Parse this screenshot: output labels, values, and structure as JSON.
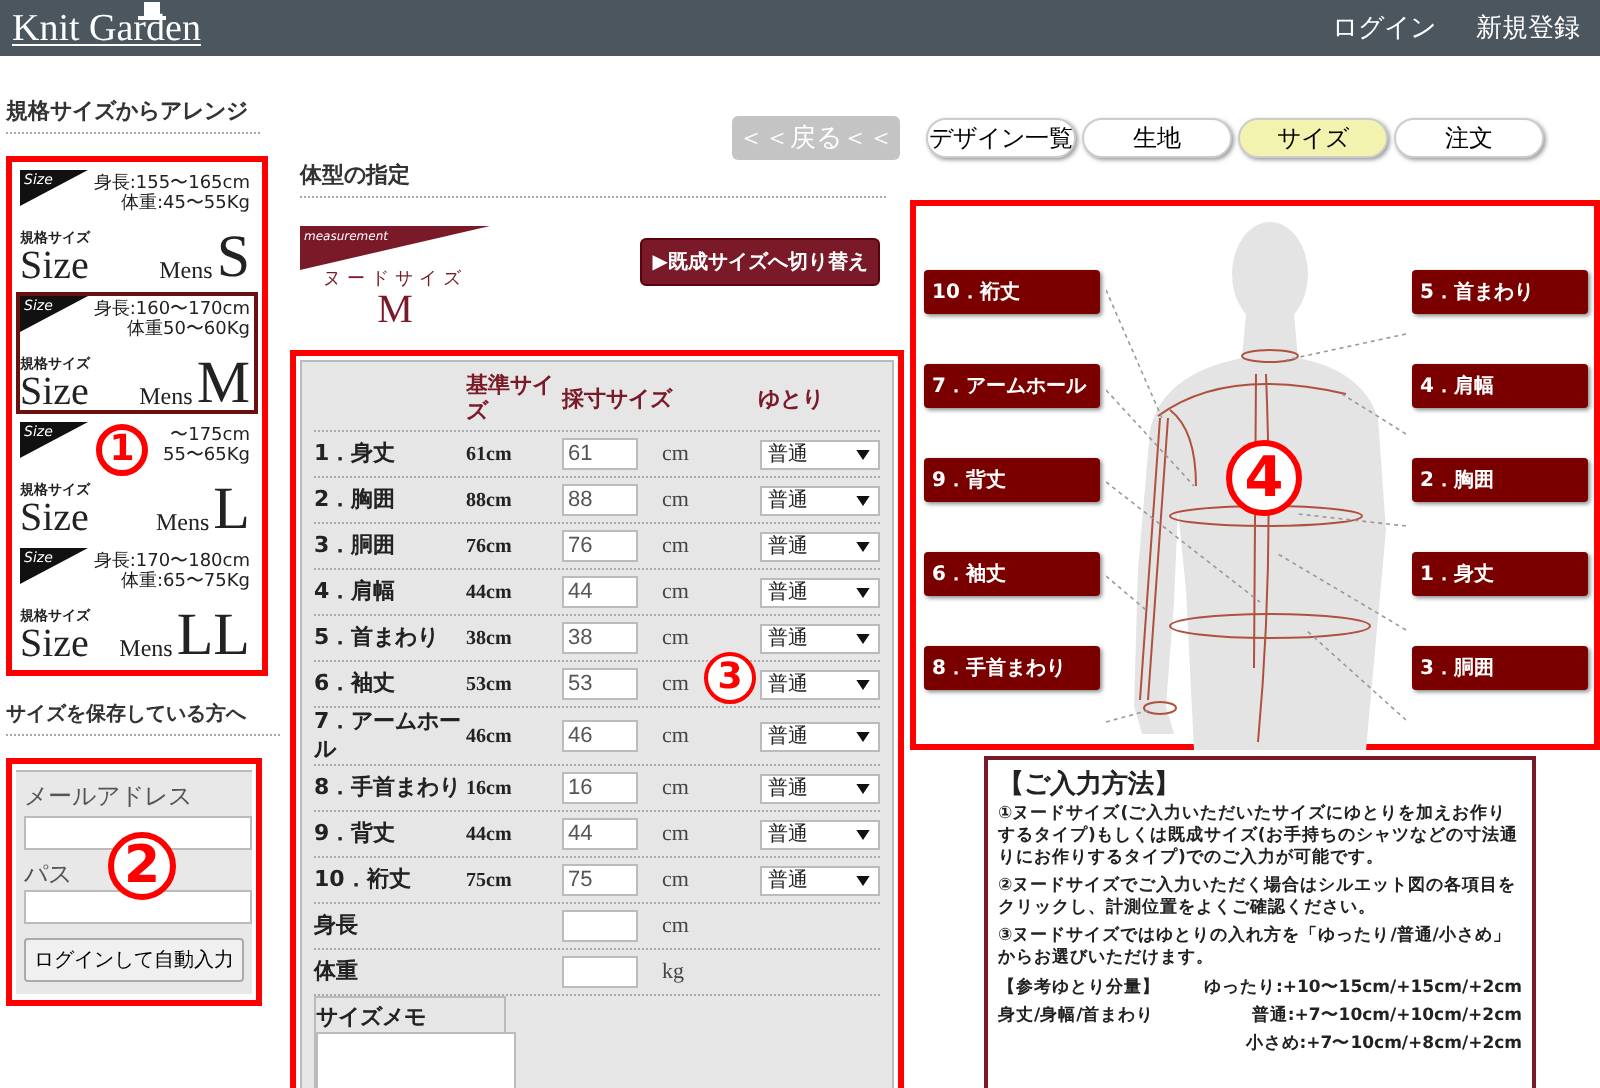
{
  "header": {
    "logo": "Knit Garden",
    "links": [
      "ログイン",
      "新規登録"
    ]
  },
  "size_preset": {
    "heading": "規格サイズからアレンジ",
    "annotation": "1",
    "cards": [
      {
        "tag": "Size",
        "height": "身長:155〜165cm",
        "weight": "体重:45〜55Kg",
        "caption": "規格サイズ",
        "size_word": "Size",
        "gender": "Mens",
        "size": "S",
        "selected": false
      },
      {
        "tag": "Size",
        "height": "身長:160〜170cm",
        "weight": "体重50〜60Kg",
        "caption": "規格サイズ",
        "size_word": "Size",
        "gender": "Mens",
        "size": "M",
        "selected": true
      },
      {
        "tag": "Size",
        "height": "〜175cm",
        "weight": "55〜65Kg",
        "caption": "規格サイズ",
        "size_word": "Size",
        "gender": "Mens",
        "size": "L",
        "selected": false
      },
      {
        "tag": "Size",
        "height": "身長:170〜180cm",
        "weight": "体重:65〜75Kg",
        "caption": "規格サイズ",
        "size_word": "Size",
        "gender": "Mens",
        "size": "LL",
        "selected": false
      }
    ]
  },
  "saved_login": {
    "heading": "サイズを保存している方へ",
    "annotation": "2",
    "email_label": "メールアドレス",
    "password_label": "パス",
    "button": "ログインして自動入力"
  },
  "back_button": "＜＜戻る＜＜",
  "body_spec": {
    "heading": "体型の指定",
    "banner": "measurement",
    "mode": "ヌードサイズ",
    "size": "M",
    "switch_button": "▶既成サイズへ切り替え",
    "annotation": "3",
    "columns": [
      "基準サイズ",
      "採寸サイズ",
      "ゆとり"
    ],
    "rows": [
      {
        "kind": "measure",
        "label": "1．身丈",
        "base": "61cm",
        "value": "61",
        "unit": "cm",
        "allowance": "普通"
      },
      {
        "kind": "measure",
        "label": "2．胸囲",
        "base": "88cm",
        "value": "88",
        "unit": "cm",
        "allowance": "普通"
      },
      {
        "kind": "measure",
        "label": "3．胴囲",
        "base": "76cm",
        "value": "76",
        "unit": "cm",
        "allowance": "普通"
      },
      {
        "kind": "measure",
        "label": "4．肩幅",
        "base": "44cm",
        "value": "44",
        "unit": "cm",
        "allowance": "普通"
      },
      {
        "kind": "measure",
        "label": "5．首まわり",
        "base": "38cm",
        "value": "38",
        "unit": "cm",
        "allowance": "普通"
      },
      {
        "kind": "measure",
        "label": "6．袖丈",
        "base": "53cm",
        "value": "53",
        "unit": "cm",
        "allowance": "普通"
      },
      {
        "kind": "measure",
        "label": "7．アームホール",
        "base": "46cm",
        "value": "46",
        "unit": "cm",
        "allowance": "普通"
      },
      {
        "kind": "measure",
        "label": "8．手首まわり",
        "base": "16cm",
        "value": "16",
        "unit": "cm",
        "allowance": "普通"
      },
      {
        "kind": "measure",
        "label": "9．背丈",
        "base": "44cm",
        "value": "44",
        "unit": "cm",
        "allowance": "普通"
      },
      {
        "kind": "measure",
        "label": "10．裄丈",
        "base": "75cm",
        "value": "75",
        "unit": "cm",
        "allowance": "普通"
      },
      {
        "kind": "plain",
        "label": "身長",
        "unit": "cm"
      },
      {
        "kind": "plain",
        "label": "体重",
        "unit": "kg"
      },
      {
        "kind": "memo",
        "label": "サイズメモ"
      }
    ]
  },
  "tabs": [
    {
      "label": "デザイン一覧",
      "selected": false
    },
    {
      "label": "生地",
      "selected": false
    },
    {
      "label": "サイズ",
      "selected": true
    },
    {
      "label": "注文",
      "selected": false
    }
  ],
  "figure": {
    "annotation": "4",
    "left_labels": [
      "10．裄丈",
      "7．アームホール",
      "9．背丈",
      "6．袖丈",
      "8．手首まわり"
    ],
    "right_labels": [
      "5．首まわり",
      "4．肩幅",
      "2．胸囲",
      "1．身丈",
      "3．胴囲"
    ]
  },
  "info": {
    "title": "【ご入力方法】",
    "paragraphs": [
      "①**ヌードサイズ**(ご入力いただいたサイズにゆとりを加えお作りするタイプ)もしくは**既成サイズ**(お手持ちのシャツなどの寸法通りにお作りするタイプ)でのご入力が可能です。",
      "②ヌードサイズでご入力いただく場合は**シルエット図の各項目をクリック**し、計測位置をよくご確認ください。",
      "③ヌードサイズでは**ゆとりの入れ方**を「ゆったり/普通/小さめ」からお選びいただけます。"
    ],
    "reference": [
      {
        "label": "【参考ゆとり分量】",
        "value": "ゆったり:+10〜15cm/+15cm/+2cm"
      },
      {
        "label": "身丈/身幅/首まわり",
        "value": "普通:+7〜10cm/+10cm/+2cm"
      },
      {
        "value": "小さめ:+7〜10cm/+8cm/+2cm"
      }
    ]
  }
}
